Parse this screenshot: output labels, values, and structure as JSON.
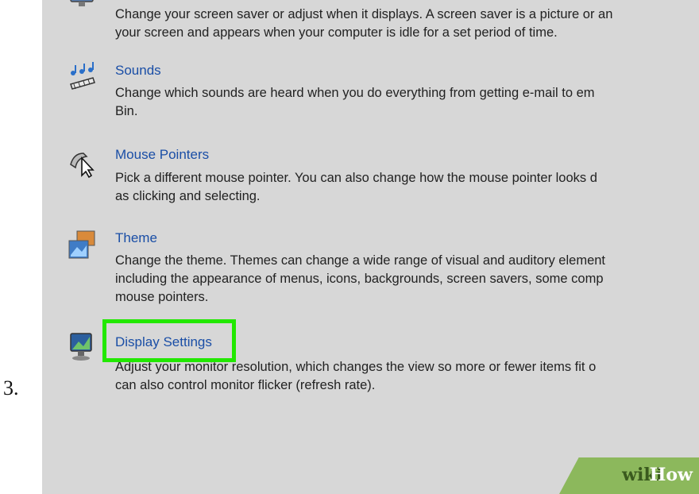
{
  "step": {
    "number": "3."
  },
  "items": [
    {
      "title": "",
      "icon": "screen-saver-icon",
      "desc_lines": [
        "Change your screen saver or adjust when it displays. A screen saver is a picture or an",
        "your screen and appears when your computer is idle for a set period of time."
      ]
    },
    {
      "title": "Sounds",
      "icon": "sounds-icon",
      "desc_lines": [
        "Change which sounds are heard when you do everything from getting e-mail to em",
        "Bin."
      ]
    },
    {
      "title": "Mouse Pointers",
      "icon": "mouse-pointer-icon",
      "desc_lines": [
        "Pick a different mouse pointer. You can also change how the mouse pointer looks d",
        "as clicking and selecting."
      ]
    },
    {
      "title": "Theme",
      "icon": "theme-icon",
      "desc_lines": [
        "Change the theme. Themes can change a wide range of visual and auditory element",
        "including the appearance of menus, icons, backgrounds, screen savers, some comp",
        "mouse pointers."
      ]
    },
    {
      "title": "Display Settings",
      "icon": "monitor-icon",
      "desc_lines": [
        "Adjust your monitor resolution, which changes the view so more or fewer items fit o",
        "can also control monitor flicker (refresh rate)."
      ]
    }
  ],
  "highlight": {
    "color": "#22e800",
    "target": "Display Settings"
  },
  "watermark": {
    "wiki": "wiki",
    "how": "How",
    "color": "#8cb85c"
  },
  "colors": {
    "background": "#d7d7d7",
    "link": "#1a4ea6",
    "text": "#222222"
  }
}
